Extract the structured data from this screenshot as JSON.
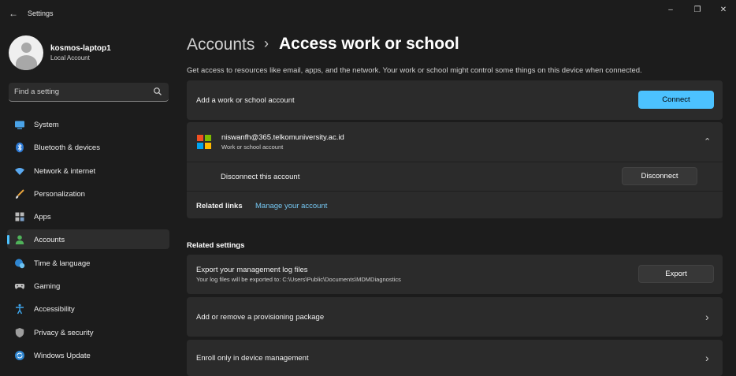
{
  "window": {
    "app_title": "Settings",
    "controls": {
      "minimize": "–",
      "maximize": "❐",
      "close": "✕"
    }
  },
  "user": {
    "name": "kosmos-laptop1",
    "account_type": "Local Account"
  },
  "search": {
    "placeholder": "Find a setting",
    "icon": "search-icon"
  },
  "nav": [
    {
      "label": "System",
      "icon": "system-icon"
    },
    {
      "label": "Bluetooth & devices",
      "icon": "bluetooth-icon"
    },
    {
      "label": "Network & internet",
      "icon": "wifi-icon"
    },
    {
      "label": "Personalization",
      "icon": "brush-icon"
    },
    {
      "label": "Apps",
      "icon": "apps-icon"
    },
    {
      "label": "Accounts",
      "icon": "person-icon",
      "active": true
    },
    {
      "label": "Time & language",
      "icon": "globe-clock-icon"
    },
    {
      "label": "Gaming",
      "icon": "gamepad-icon"
    },
    {
      "label": "Accessibility",
      "icon": "accessibility-icon"
    },
    {
      "label": "Privacy & security",
      "icon": "shield-icon"
    },
    {
      "label": "Windows Update",
      "icon": "update-icon"
    }
  ],
  "header": {
    "breadcrumb": "Accounts",
    "separator": "›",
    "title": "Access work or school",
    "description": "Get access to resources like email, apps, and the network. Your work or school might control some things on this device when connected."
  },
  "add_account": {
    "label": "Add a work or school account",
    "button": "Connect"
  },
  "account": {
    "email": "niswanfh@365.telkomuniversity.ac.id",
    "type": "Work or school account",
    "disconnect_label": "Disconnect this account",
    "disconnect_button": "Disconnect",
    "related_links_label": "Related links",
    "manage_link": "Manage your account"
  },
  "related_settings": {
    "title": "Related settings",
    "export": {
      "label": "Export your management log files",
      "sub": "Your log files will be exported to: C:\\Users\\Public\\Documents\\MDMDiagnostics",
      "button": "Export"
    },
    "provisioning": "Add or remove a provisioning package",
    "enroll": "Enroll only in device management"
  },
  "colors": {
    "accent": "#4cc2ff",
    "background": "#1c1c1c",
    "card": "#2b2b2b",
    "link": "#76c8f3",
    "ms_red": "#f25022",
    "ms_green": "#7fba00",
    "ms_blue": "#00a4ef",
    "ms_yellow": "#ffb900"
  }
}
